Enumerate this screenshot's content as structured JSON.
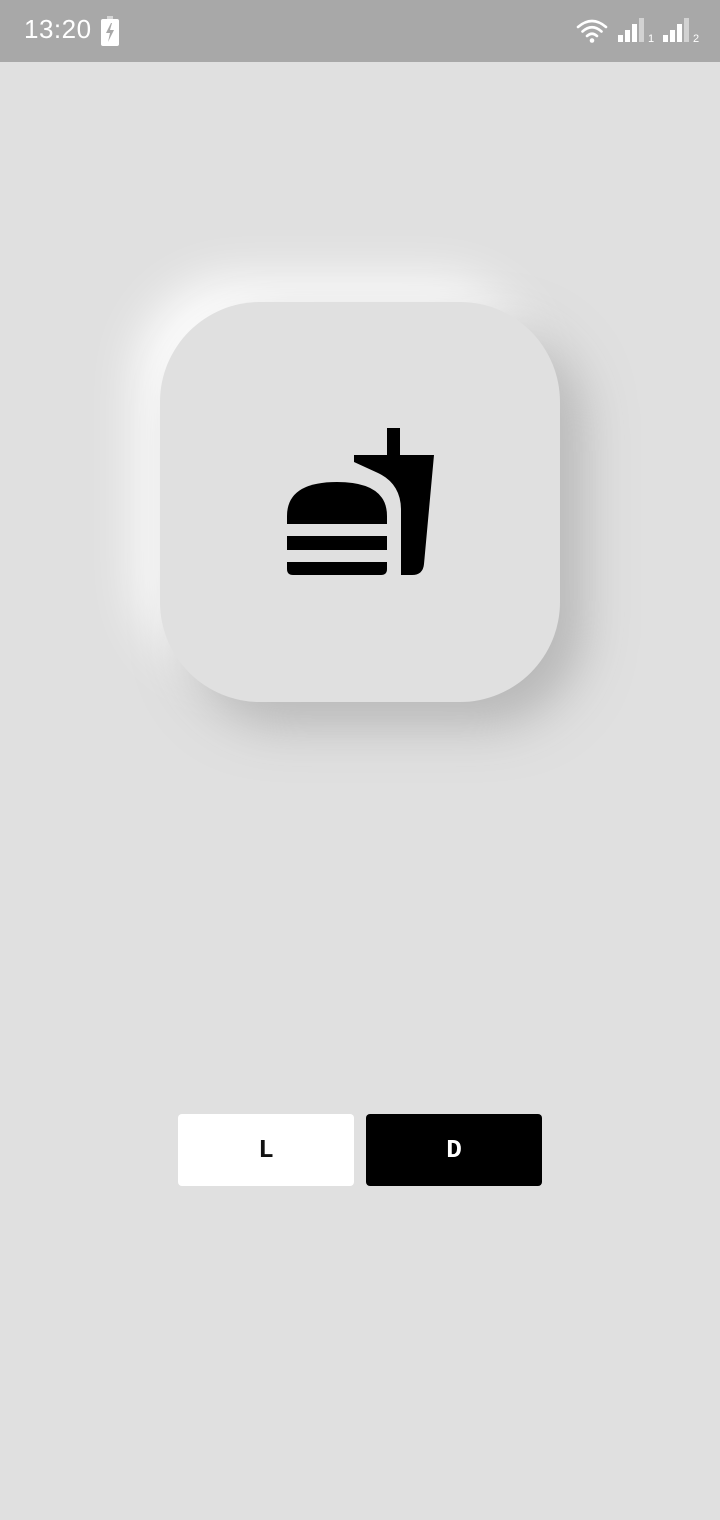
{
  "status_bar": {
    "time": "13:20",
    "sim1_label": "1",
    "sim2_label": "2",
    "icons": [
      "battery-charging-icon",
      "wifi-icon",
      "signal-icon",
      "signal-icon"
    ]
  },
  "card": {
    "icon": "fastfood-icon"
  },
  "buttons": {
    "light_label": "L",
    "dark_label": "D"
  },
  "colors": {
    "background": "#e0e0e0",
    "status_bar": "#a8a8a8",
    "light_button": "#ffffff",
    "dark_button": "#000000",
    "icon": "#000000"
  }
}
